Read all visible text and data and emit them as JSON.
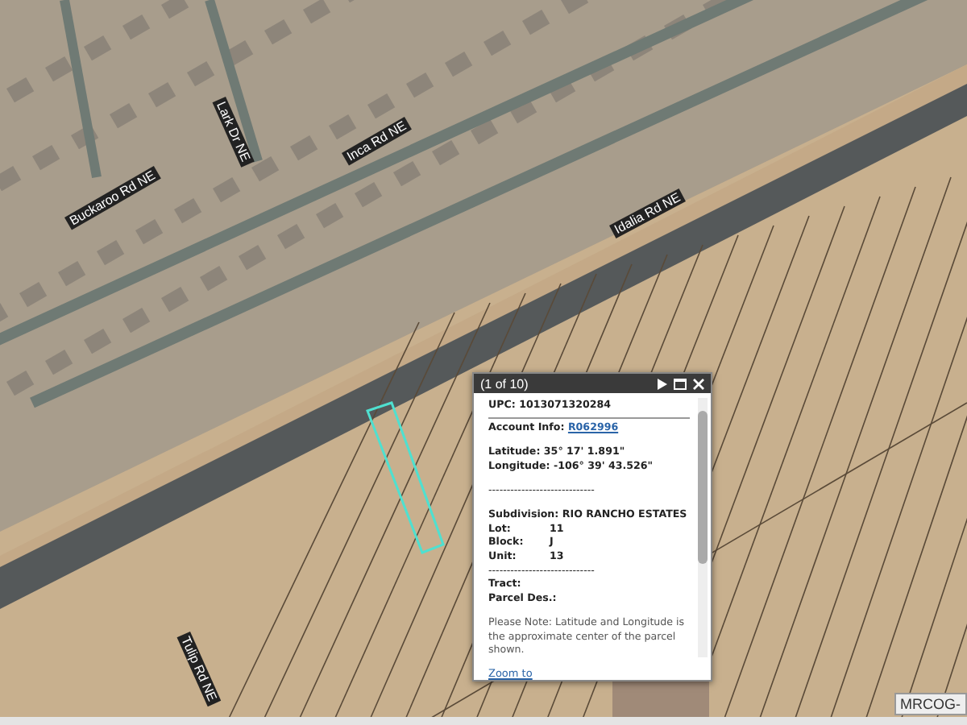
{
  "map": {
    "street_labels": [
      {
        "text": "Buckaroo Rd NE"
      },
      {
        "text": "Lark Dr NE"
      },
      {
        "text": "Inca Rd NE"
      },
      {
        "text": "Idalia Rd NE"
      },
      {
        "text": "Tulip Rd NE"
      }
    ],
    "attribution": "MRCOG-"
  },
  "popup": {
    "counter": "(1 of 10)",
    "lines": [
      {
        "kind": "field",
        "label": "UPC:",
        "value": "1013071320284"
      },
      {
        "kind": "rule"
      },
      {
        "kind": "link",
        "label": "Account Info:",
        "value": "R062996"
      },
      {
        "kind": "gap"
      },
      {
        "kind": "field",
        "label": "Latitude:",
        "value": "35° 17' 1.891\""
      },
      {
        "kind": "field",
        "label": "Longitude:",
        "value": "-106° 39' 43.526\""
      },
      {
        "kind": "gap"
      },
      {
        "kind": "dashes",
        "text": "-----------------------------"
      },
      {
        "kind": "gap"
      },
      {
        "kind": "field",
        "label": "Subdivision:",
        "value": "RIO RANCHO ESTATES"
      },
      {
        "kind": "column",
        "label": "Lot:",
        "value": "11"
      },
      {
        "kind": "column",
        "label": "Block:",
        "value": "J"
      },
      {
        "kind": "column",
        "label": "Unit:",
        "value": "13"
      },
      {
        "kind": "dashes",
        "text": "-----------------------------"
      },
      {
        "kind": "field",
        "label": "Tract:"
      },
      {
        "kind": "field",
        "label": "Parcel Des.:"
      },
      {
        "kind": "gap"
      },
      {
        "kind": "note",
        "text": "Please Note: Latitude and Longitude is the approximate center of the parcel shown."
      }
    ],
    "zoom_link": "Zoom to"
  }
}
